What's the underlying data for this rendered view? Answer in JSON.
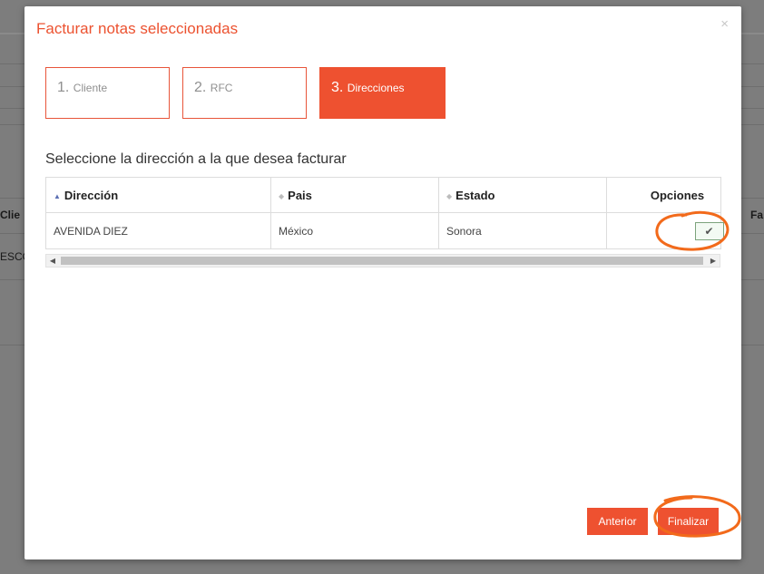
{
  "background": {
    "column_left": "Clie",
    "row_left": "ESCO",
    "column_right": "Fa"
  },
  "modal": {
    "title": "Facturar notas seleccionadas",
    "close_symbol": "×"
  },
  "steps": [
    {
      "number": "1.",
      "label": "Cliente",
      "active": false
    },
    {
      "number": "2.",
      "label": "RFC",
      "active": false
    },
    {
      "number": "3.",
      "label": "Direcciones",
      "active": true
    }
  ],
  "section_label": "Seleccione la dirección a la que desea facturar",
  "table": {
    "columns": [
      "Dirección",
      "Pais",
      "Estado",
      "Opciones"
    ],
    "rows": [
      {
        "direccion": "AVENIDA DIEZ",
        "pais": "México",
        "estado": "Sonora",
        "option_icon": "✔"
      }
    ]
  },
  "buttons": {
    "anterior": "Anterior",
    "finalizar": "Finalizar"
  },
  "colors": {
    "accent": "#ee5130",
    "annotation": "#f26a1b"
  }
}
